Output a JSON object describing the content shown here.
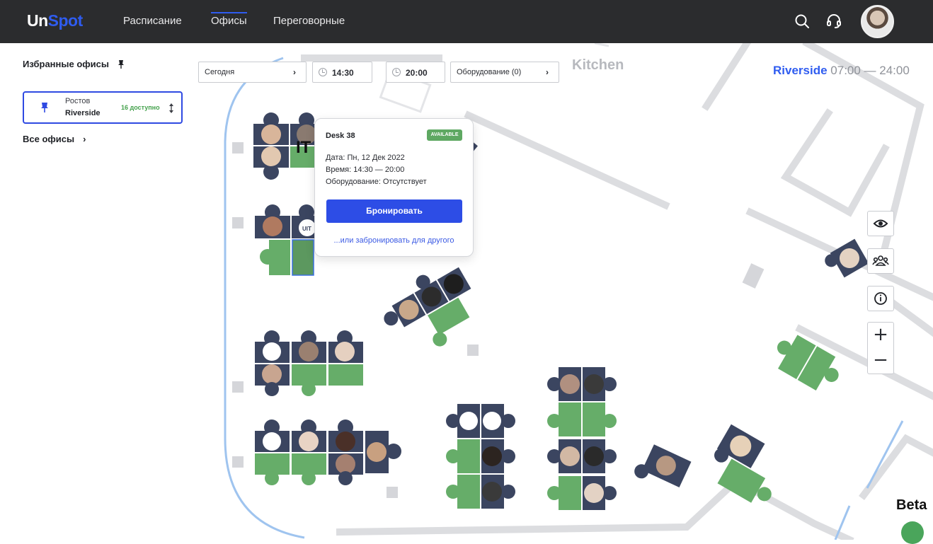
{
  "app": {
    "logo_un": "Un",
    "logo_spot": "Spot",
    "nav": [
      {
        "label": "Расписание",
        "active": false
      },
      {
        "label": "Офисы",
        "active": true
      },
      {
        "label": "Переговорные",
        "active": false
      }
    ],
    "icons": [
      "search-icon",
      "support-headset-icon",
      "user-avatar"
    ]
  },
  "sidebar": {
    "favorites_title": "Избранные офисы",
    "office": {
      "city": "Ростов",
      "name": "Riverside",
      "availability": "16 доступно"
    },
    "all_offices_label": "Все офисы"
  },
  "filters": {
    "date": "Сегодня",
    "time_from": "14:30",
    "time_to": "20:00",
    "equipment": "Оборудование (0)"
  },
  "office_header": {
    "name": "Riverside",
    "hours": "07:00 — 24:00"
  },
  "map": {
    "room_label": "Kitchen",
    "team_label": "IT",
    "logo_text": "UIT",
    "colors": {
      "desk_free": "#66ad69",
      "desk_busy": "#3b4560",
      "wall": "#dcdde0",
      "route": "#9fc4ef"
    }
  },
  "popup": {
    "title": "Desk 38",
    "status": "AVAILABLE",
    "date": "Дата: Пн, 12 Дек 2022",
    "time": "Время: 14:30 — 20:00",
    "equipment": "Оборудование: Отсутствует",
    "book_button": "Бронировать",
    "book_other_link": "...или забронировать для другого"
  },
  "controls": {
    "zoom_in": "+",
    "zoom_out": "−",
    "icons": [
      "eye-icon",
      "people-icon",
      "info-icon"
    ]
  },
  "beta_label": "Beta"
}
